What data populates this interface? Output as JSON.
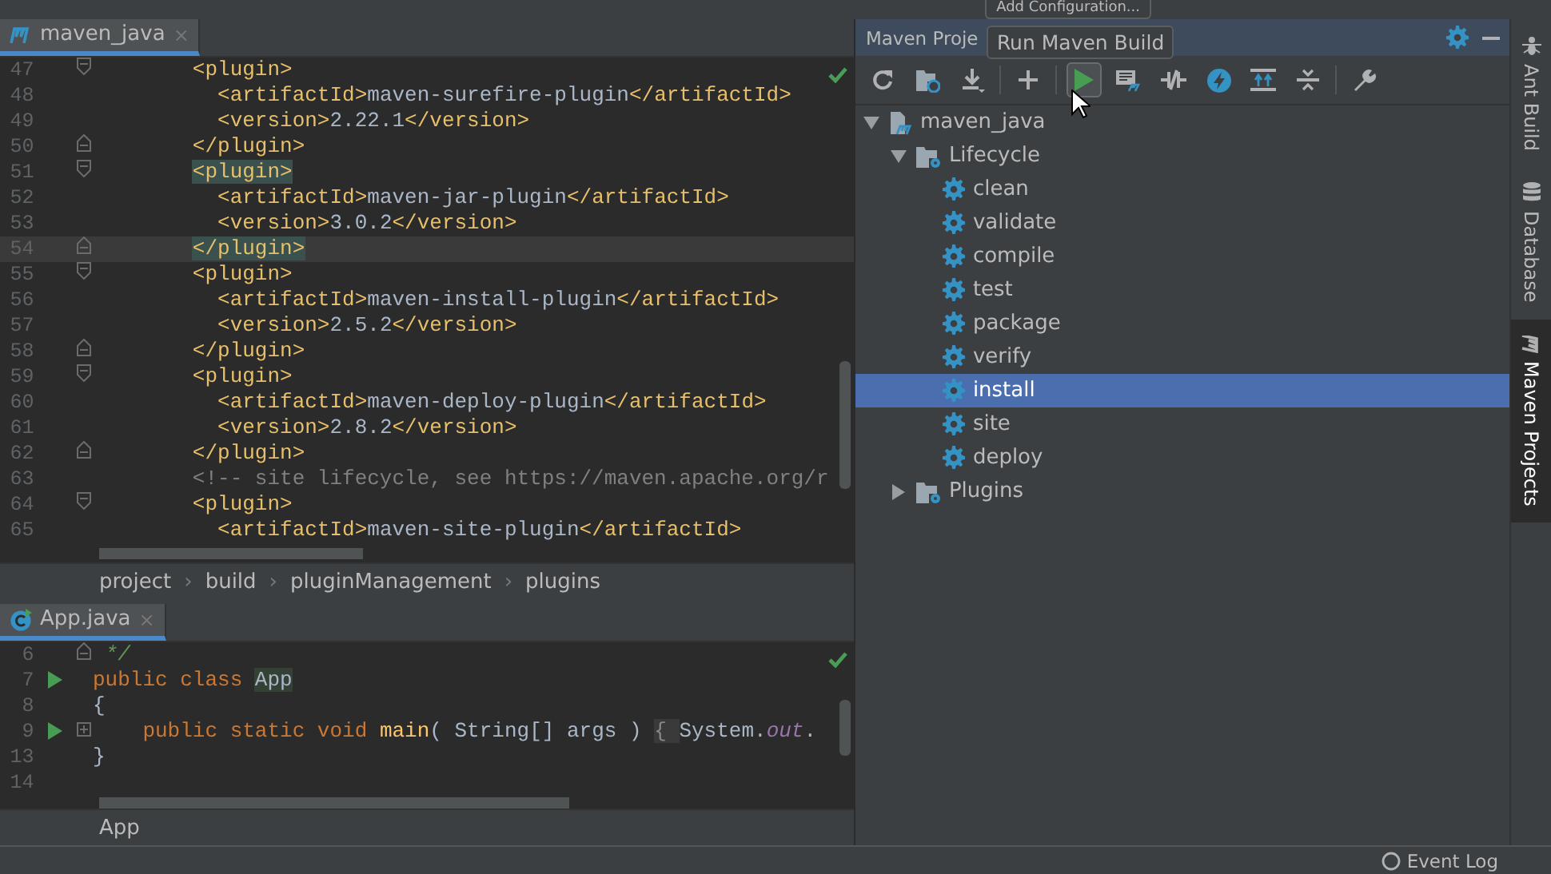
{
  "top_bar": {
    "run_config": "Add Configuration..."
  },
  "editor": {
    "tab": {
      "label": "maven_java",
      "close": "×",
      "selected": true
    },
    "lines": [
      {
        "number": "47",
        "kind": "fold-start",
        "current": false,
        "tokens": [
          {
            "kind": "tag",
            "text": "        <plugin>"
          }
        ]
      },
      {
        "number": "48",
        "kind": "plain",
        "current": false,
        "tokens": [
          {
            "kind": "tag",
            "text": "          <artifactId>"
          },
          {
            "kind": "text",
            "text": "maven-surefire-plugin"
          },
          {
            "kind": "tag",
            "text": "</artifactId>"
          }
        ]
      },
      {
        "number": "49",
        "kind": "plain",
        "current": false,
        "tokens": [
          {
            "kind": "tag",
            "text": "          <version>"
          },
          {
            "kind": "text",
            "text": "2.22.1"
          },
          {
            "kind": "tag",
            "text": "</version>"
          }
        ]
      },
      {
        "number": "50",
        "kind": "fold-end",
        "current": false,
        "tokens": [
          {
            "kind": "tag",
            "text": "        </plugin>"
          }
        ]
      },
      {
        "number": "51",
        "kind": "fold-start",
        "current": false,
        "tokens": [
          {
            "kind": "match",
            "text": "        <plugin>"
          }
        ]
      },
      {
        "number": "52",
        "kind": "plain",
        "current": false,
        "tokens": [
          {
            "kind": "tag",
            "text": "          <artifactId>"
          },
          {
            "kind": "text",
            "text": "maven-jar-plugin"
          },
          {
            "kind": "tag",
            "text": "</artifactId>"
          }
        ]
      },
      {
        "number": "53",
        "kind": "plain",
        "current": false,
        "tokens": [
          {
            "kind": "tag",
            "text": "          <version>"
          },
          {
            "kind": "text",
            "text": "3.0.2"
          },
          {
            "kind": "tag",
            "text": "</version>"
          }
        ]
      },
      {
        "number": "54",
        "kind": "fold-end",
        "current": true,
        "tokens": [
          {
            "kind": "match",
            "text": "        </plugin>"
          }
        ]
      },
      {
        "number": "55",
        "kind": "fold-start",
        "current": false,
        "tokens": [
          {
            "kind": "tag",
            "text": "        <plugin>"
          }
        ]
      },
      {
        "number": "56",
        "kind": "plain",
        "current": false,
        "tokens": [
          {
            "kind": "tag",
            "text": "          <artifactId>"
          },
          {
            "kind": "text",
            "text": "maven-install-plugin"
          },
          {
            "kind": "tag",
            "text": "</artifactId>"
          }
        ]
      },
      {
        "number": "57",
        "kind": "plain",
        "current": false,
        "tokens": [
          {
            "kind": "tag",
            "text": "          <version>"
          },
          {
            "kind": "text",
            "text": "2.5.2"
          },
          {
            "kind": "tag",
            "text": "</version>"
          }
        ]
      },
      {
        "number": "58",
        "kind": "fold-end",
        "current": false,
        "tokens": [
          {
            "kind": "tag",
            "text": "        </plugin>"
          }
        ]
      },
      {
        "number": "59",
        "kind": "fold-start",
        "current": false,
        "tokens": [
          {
            "kind": "tag",
            "text": "        <plugin>"
          }
        ]
      },
      {
        "number": "60",
        "kind": "plain",
        "current": false,
        "tokens": [
          {
            "kind": "tag",
            "text": "          <artifactId>"
          },
          {
            "kind": "text",
            "text": "maven-deploy-plugin"
          },
          {
            "kind": "tag",
            "text": "</artifactId>"
          }
        ]
      },
      {
        "number": "61",
        "kind": "plain",
        "current": false,
        "tokens": [
          {
            "kind": "tag",
            "text": "          <version>"
          },
          {
            "kind": "text",
            "text": "2.8.2"
          },
          {
            "kind": "tag",
            "text": "</version>"
          }
        ]
      },
      {
        "number": "62",
        "kind": "fold-end",
        "current": false,
        "tokens": [
          {
            "kind": "tag",
            "text": "        </plugin>"
          }
        ]
      },
      {
        "number": "63",
        "kind": "plain",
        "current": false,
        "tokens": [
          {
            "kind": "comment",
            "text": "        <!-- site lifecycle, see https://maven.apache.org/r"
          }
        ]
      },
      {
        "number": "64",
        "kind": "fold-start",
        "current": false,
        "tokens": [
          {
            "kind": "tag",
            "text": "        <plugin>"
          }
        ]
      },
      {
        "number": "65",
        "kind": "plain",
        "current": false,
        "tokens": [
          {
            "kind": "tag",
            "text": "          <artifactId>"
          },
          {
            "kind": "text",
            "text": "maven-site-plugin"
          },
          {
            "kind": "tag",
            "text": "</artifactId>"
          }
        ]
      }
    ],
    "breadcrumb": [
      {
        "label": "project"
      },
      {
        "separator": "›",
        "label": "build"
      },
      {
        "separator": "›",
        "label": "pluginManagement"
      },
      {
        "separator": "›",
        "label": "plugins"
      }
    ]
  },
  "editor2": {
    "tab": {
      "label": "App.java",
      "close": "×",
      "selected": true
    },
    "lines": [
      {
        "number": "6",
        "kind": "fold-end",
        "run": false,
        "tokens": [
          {
            "kind": "doc",
            "text": " */"
          }
        ]
      },
      {
        "number": "7",
        "kind": "plain",
        "run": true,
        "tokens": [
          {
            "kind": "keyword",
            "text": "public class "
          },
          {
            "kind": "classdef",
            "text": "App"
          }
        ]
      },
      {
        "number": "8",
        "kind": "plain",
        "run": false,
        "tokens": [
          {
            "kind": "plain",
            "text": "{"
          }
        ]
      },
      {
        "number": "9",
        "kind": "folded",
        "run": true,
        "tokens": [
          {
            "kind": "keyword",
            "text": "    public static void "
          },
          {
            "kind": "method",
            "text": "main"
          },
          {
            "kind": "plain",
            "text": "( String[] args ) "
          },
          {
            "kind": "folded",
            "text": "{ "
          },
          {
            "kind": "plain",
            "text": "System."
          },
          {
            "kind": "field",
            "text": "out"
          },
          {
            "kind": "plain",
            "text": "."
          }
        ]
      },
      {
        "number": "13",
        "kind": "plain",
        "run": false,
        "tokens": [
          {
            "kind": "plain",
            "text": "}"
          }
        ]
      },
      {
        "number": "14",
        "kind": "plain",
        "run": false
      }
    ],
    "breadcrumb": [
      {
        "label": "App"
      }
    ]
  },
  "maven": {
    "title": "Maven Proje",
    "tooltip": "Run Maven Build",
    "toolbar": [
      {
        "kind": "refresh",
        "selected": false
      },
      {
        "kind": "folder-refresh",
        "selected": false
      },
      {
        "kind": "download",
        "selected": false
      },
      {
        "kind": "sep"
      },
      {
        "kind": "plus",
        "selected": false
      },
      {
        "kind": "sep"
      },
      {
        "kind": "run",
        "selected": true
      },
      {
        "kind": "run-config",
        "selected": false
      },
      {
        "kind": "offline",
        "selected": false
      },
      {
        "kind": "lightning",
        "selected": false
      },
      {
        "kind": "expand",
        "selected": false
      },
      {
        "kind": "collapse",
        "selected": false
      },
      {
        "kind": "sep"
      },
      {
        "kind": "wrench",
        "selected": false
      }
    ],
    "tree": [
      {
        "kind": "project",
        "label": "maven_java",
        "expanded": true,
        "selected": false,
        "children": [
          {
            "kind": "folder",
            "label": "Lifecycle",
            "expanded": true,
            "selected": false,
            "children": [
              {
                "kind": "goal",
                "label": "clean",
                "selected": false
              },
              {
                "kind": "goal",
                "label": "validate",
                "selected": false
              },
              {
                "kind": "goal",
                "label": "compile",
                "selected": false
              },
              {
                "kind": "goal",
                "label": "test",
                "selected": false
              },
              {
                "kind": "goal",
                "label": "package",
                "selected": false
              },
              {
                "kind": "goal",
                "label": "verify",
                "selected": false
              },
              {
                "kind": "goal",
                "label": "install",
                "selected": true
              },
              {
                "kind": "goal",
                "label": "site",
                "selected": false
              },
              {
                "kind": "goal",
                "label": "deploy",
                "selected": false
              }
            ]
          },
          {
            "kind": "folder",
            "label": "Plugins",
            "expanded": false,
            "selected": false
          }
        ]
      }
    ]
  },
  "side_tabs": [
    {
      "label": "Ant Build",
      "kind": "ant",
      "selected": false
    },
    {
      "label": "Database",
      "kind": "database",
      "selected": false
    },
    {
      "label": "Maven Projects",
      "kind": "maven",
      "selected": true
    }
  ],
  "status_bar": {
    "event_log": "Event Log"
  }
}
